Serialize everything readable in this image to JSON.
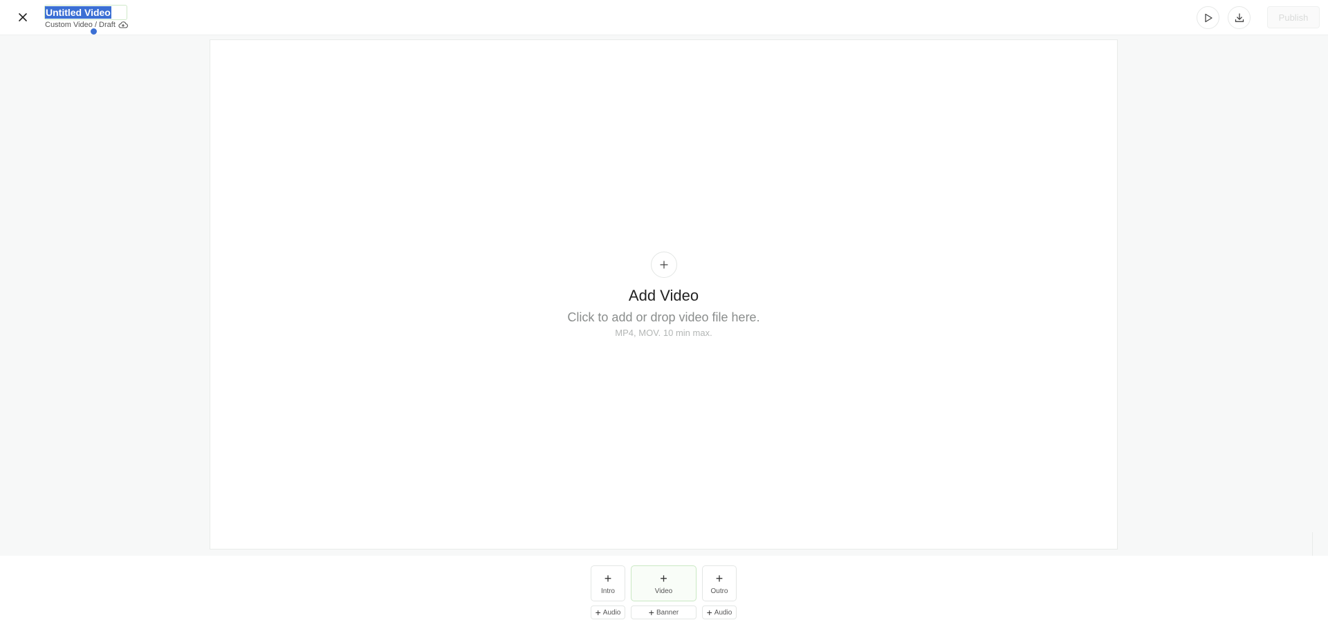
{
  "header": {
    "title": "Untitled Video",
    "subtitle": "Custom Video / Draft",
    "publish_label": "Publish"
  },
  "canvas": {
    "add_title": "Add Video",
    "add_description": "Click to add or drop video file here.",
    "add_hint": "MP4, MOV. 10 min max."
  },
  "timeline": {
    "plus": "+",
    "intro_label": "Intro",
    "video_label": "Video",
    "outro_label": "Outro",
    "audio_left_label": "Audio",
    "banner_label": "Banner",
    "audio_right_label": "Audio"
  },
  "icons": {
    "close": "close-icon",
    "cloud": "cloud-upload-icon",
    "play": "play-icon",
    "download": "download-icon",
    "add": "plus-icon"
  },
  "colors": {
    "accent_green_border": "#c9e8c3",
    "selection_blue": "#3b6fd4",
    "background": "#f7f8f8"
  }
}
